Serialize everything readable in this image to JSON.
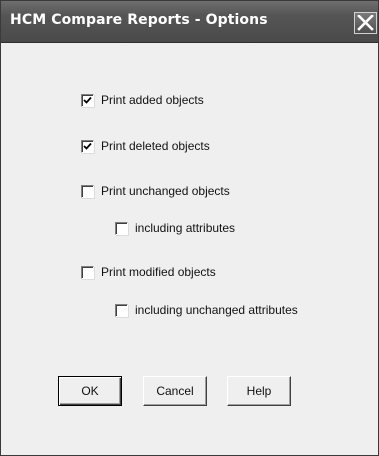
{
  "window": {
    "title": "HCM Compare Reports - Options",
    "close_icon": "close-icon"
  },
  "options": [
    {
      "label": "Print added objects",
      "checked": true
    },
    {
      "label": "Print deleted objects",
      "checked": true
    },
    {
      "label": "Print unchanged objects",
      "checked": false
    },
    {
      "label": "including attributes",
      "checked": false
    },
    {
      "label": "Print modified objects",
      "checked": false
    },
    {
      "label": "including unchanged attributes",
      "checked": false
    }
  ],
  "buttons": {
    "ok": "OK",
    "cancel": "Cancel",
    "help": "Help"
  }
}
